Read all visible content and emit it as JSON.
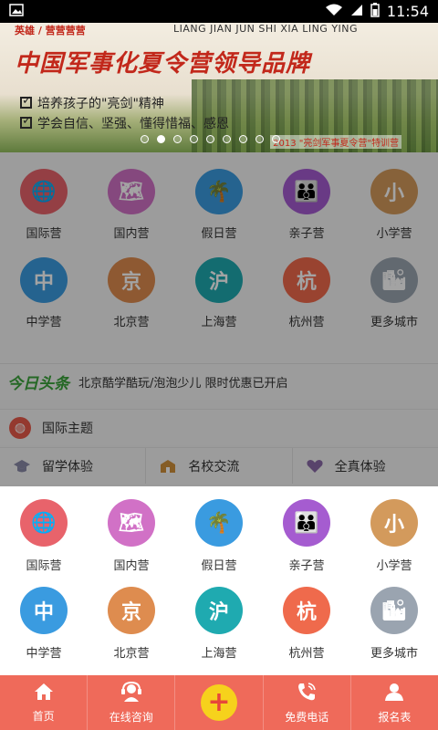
{
  "status_bar": {
    "time": "11:54"
  },
  "banner": {
    "top_text": "英雄 / 营营营营",
    "pinyin": "LIANG JIAN JUN SHI XIA LING YING",
    "headline": "中国军事化夏令营领导品牌",
    "line1": "培养孩子的\"亮剑\"精神",
    "line2": "学会自信、坚强、懂得惜福、感恩",
    "caption": "2013 \"亮剑军事夏令营\"特训营",
    "dot_count": 9,
    "active_dot": 1
  },
  "categories_row1": [
    {
      "label": "国际营",
      "icon": "globe-plane-icon",
      "color": "#e8636b",
      "glyph": "🌐"
    },
    {
      "label": "国内营",
      "icon": "china-map-icon",
      "color": "#d171c6",
      "glyph": "🗺"
    },
    {
      "label": "假日营",
      "icon": "palm-tree-icon",
      "color": "#3a9be0",
      "glyph": "🌴"
    },
    {
      "label": "亲子营",
      "icon": "parent-child-icon",
      "color": "#a55cd0",
      "glyph": "👪"
    },
    {
      "label": "小学营",
      "icon": "xiao-char-icon",
      "color": "#d39a5c",
      "glyph": "小"
    }
  ],
  "categories_row2": [
    {
      "label": "中学营",
      "icon": "zhong-char-icon",
      "color": "#3a9be0",
      "glyph": "中"
    },
    {
      "label": "北京营",
      "icon": "jing-char-icon",
      "color": "#de8c4f",
      "glyph": "京"
    },
    {
      "label": "上海营",
      "icon": "hu-char-icon",
      "color": "#1faab0",
      "glyph": "沪"
    },
    {
      "label": "杭州营",
      "icon": "hang-char-icon",
      "color": "#ef6a4c",
      "glyph": "杭"
    },
    {
      "label": "更多城市",
      "icon": "buildings-icon",
      "color": "#9aa4b0",
      "glyph": "🏙"
    }
  ],
  "headline_bar": {
    "tag": "今日头条",
    "text": "北京酷学酷玩/泡泡少儿 限时优惠已开启"
  },
  "theme": {
    "label": "国际主题"
  },
  "sub_items": [
    {
      "label": "留学体验",
      "icon": "graduation-cap-icon"
    },
    {
      "label": "名校交流",
      "icon": "school-building-icon"
    },
    {
      "label": "全真体验",
      "icon": "heart-icon"
    }
  ],
  "tabs": [
    {
      "label": "首页",
      "icon": "home-icon",
      "glyph": "⌂"
    },
    {
      "label": "在线咨询",
      "icon": "headset-icon",
      "glyph": "☎"
    },
    {
      "label": "",
      "icon": "plus-icon",
      "glyph": "+"
    },
    {
      "label": "免费电话",
      "icon": "phone-icon",
      "glyph": "✆"
    },
    {
      "label": "报名表",
      "icon": "user-icon",
      "glyph": "👤"
    }
  ]
}
